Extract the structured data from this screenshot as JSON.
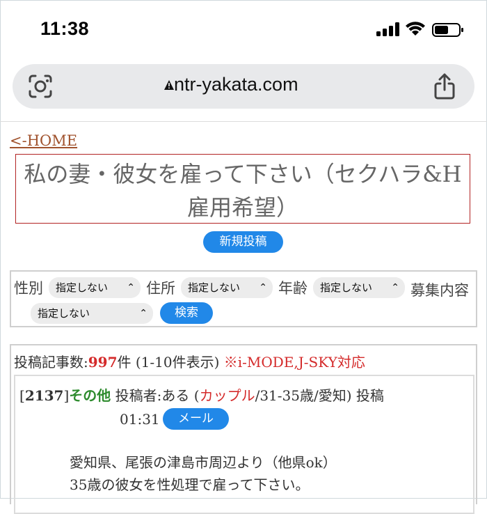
{
  "status": {
    "time": "11:38"
  },
  "browser": {
    "url": "ntr-yakata.com"
  },
  "page": {
    "home_link": "<-HOME",
    "title": "私の妻・彼女を雇って下さい（セクハラ&H雇用希望）",
    "new_post": "新規投稿",
    "filters": {
      "gender_label": "性別",
      "gender_value": "指定しない",
      "address_label": "住所",
      "address_value": "指定しない",
      "age_label": "年齢",
      "age_value": "指定しない",
      "content_label": "募集内容",
      "content_value": "指定しない",
      "search_button": "検索"
    },
    "list": {
      "count_prefix": "投稿記事数:",
      "count": "997",
      "count_suffix": "件 (1-10件表示)",
      "mobile_note": "※i-MODE,J-SKY対応"
    },
    "post": {
      "id": "2137",
      "category": "その他",
      "poster_label": "投稿者:",
      "poster": "ある",
      "type": "カップル",
      "demo": "/31-35歳/愛知)",
      "posted_label": "投稿",
      "time": "01:31",
      "mail_button": "メール",
      "body_line1": "愛知県、尾張の津島市周辺より（他県ok）",
      "body_line2": "35歳の彼女を性処理で雇って下さい。"
    }
  }
}
